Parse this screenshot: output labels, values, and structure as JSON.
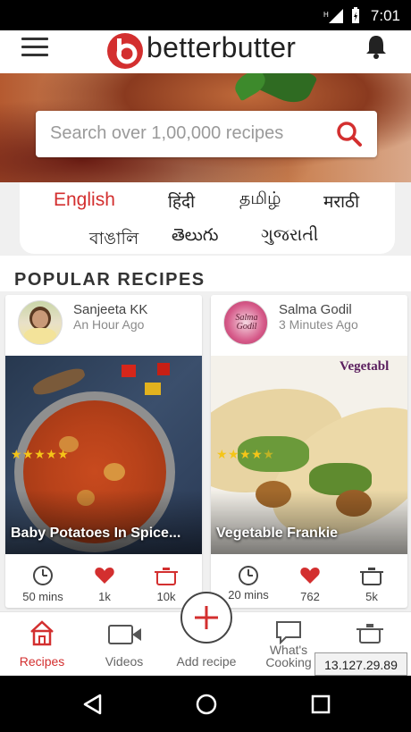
{
  "status_bar": {
    "time": "7:01"
  },
  "header": {
    "brand": "betterbutter"
  },
  "search": {
    "placeholder": "Search over 1,00,000 recipes"
  },
  "languages": [
    "English",
    "हिंदी",
    "தமிழ்",
    "मराठी",
    "বাঙালি",
    "తెలుగు",
    "ગુજરાતી"
  ],
  "section": {
    "title": "POPULAR RECIPES"
  },
  "recipes": [
    {
      "author": "Sanjeeta KK",
      "ago": "An Hour Ago",
      "title": "Baby Potatoes In Spice...",
      "rating": 5,
      "time": "50 mins",
      "likes": "1k",
      "cooked": "10k"
    },
    {
      "author": "Salma Godil",
      "ago": "3 Minutes Ago",
      "title": "Vegetable Frankie",
      "rating": 4.5,
      "time": "20 mins",
      "likes": "762",
      "cooked": "5k",
      "photo_text": "Vegetabl",
      "avatar_text": "Salma Godil"
    }
  ],
  "bottom_nav": [
    {
      "label": "Recipes",
      "active": true
    },
    {
      "label": "Videos"
    },
    {
      "label": "Add recipe"
    },
    {
      "label": "What's Cooking"
    },
    {
      "label": ""
    }
  ],
  "overlay": {
    "ip": "13.127.29.89"
  },
  "colors": {
    "brand": "#d32f2f",
    "star": "#f5c518"
  }
}
